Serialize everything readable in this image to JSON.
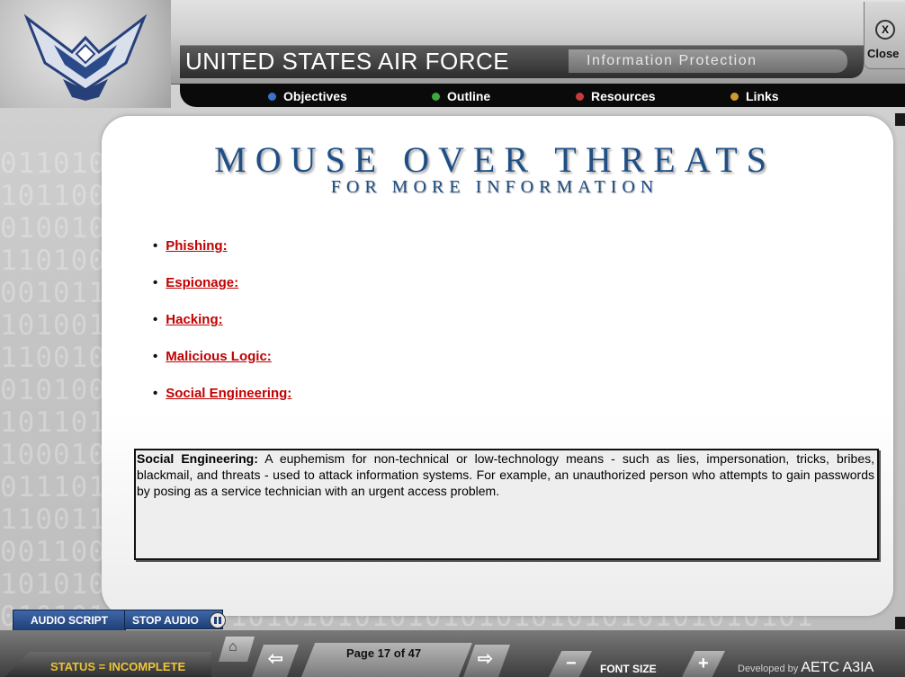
{
  "header": {
    "title": "UNITED STATES AIR FORCE",
    "subtitle": "Information Protection",
    "close_label": "Close",
    "close_symbol": "X"
  },
  "nav": [
    {
      "label": "Objectives",
      "color": "#3a74c9"
    },
    {
      "label": "Outline",
      "color": "#3cab3c"
    },
    {
      "label": "Resources",
      "color": "#c83b3b"
    },
    {
      "label": "Links",
      "color": "#d1992e"
    }
  ],
  "content": {
    "heading": "MOUSE OVER THREATS",
    "subheading": "FOR MORE INFORMATION",
    "threats": [
      "Phishing:",
      "Espionage:",
      "Hacking:",
      "Malicious Logic:",
      "Social Engineering:"
    ],
    "info_title": "Social Engineering:",
    "info_body": "A euphemism for non-technical or low-technology means - such as lies, impersonation, tricks, bribes, blackmail, and threats - used to attack information systems. For example, an unauthorized person who attempts to gain passwords by posing as a service technician with an urgent access problem."
  },
  "audio": {
    "script_label": "AUDIO SCRIPT",
    "stop_label": "STOP AUDIO"
  },
  "footer": {
    "status_label": "STATUS = ",
    "status_value": "INCOMPLETE",
    "page": "Page 17 of 47",
    "font_size_label": "FONT SIZE",
    "font_minus": "−",
    "font_plus": "+",
    "prev_arrow": "⇦",
    "next_arrow": "⇨",
    "developed_by": "Developed by ",
    "developer": "AETC A3IA"
  },
  "colors": {
    "heading": "#1f4f86",
    "link": "#c00000",
    "status": "#f0c53a",
    "audio": "#2a4f8f"
  }
}
